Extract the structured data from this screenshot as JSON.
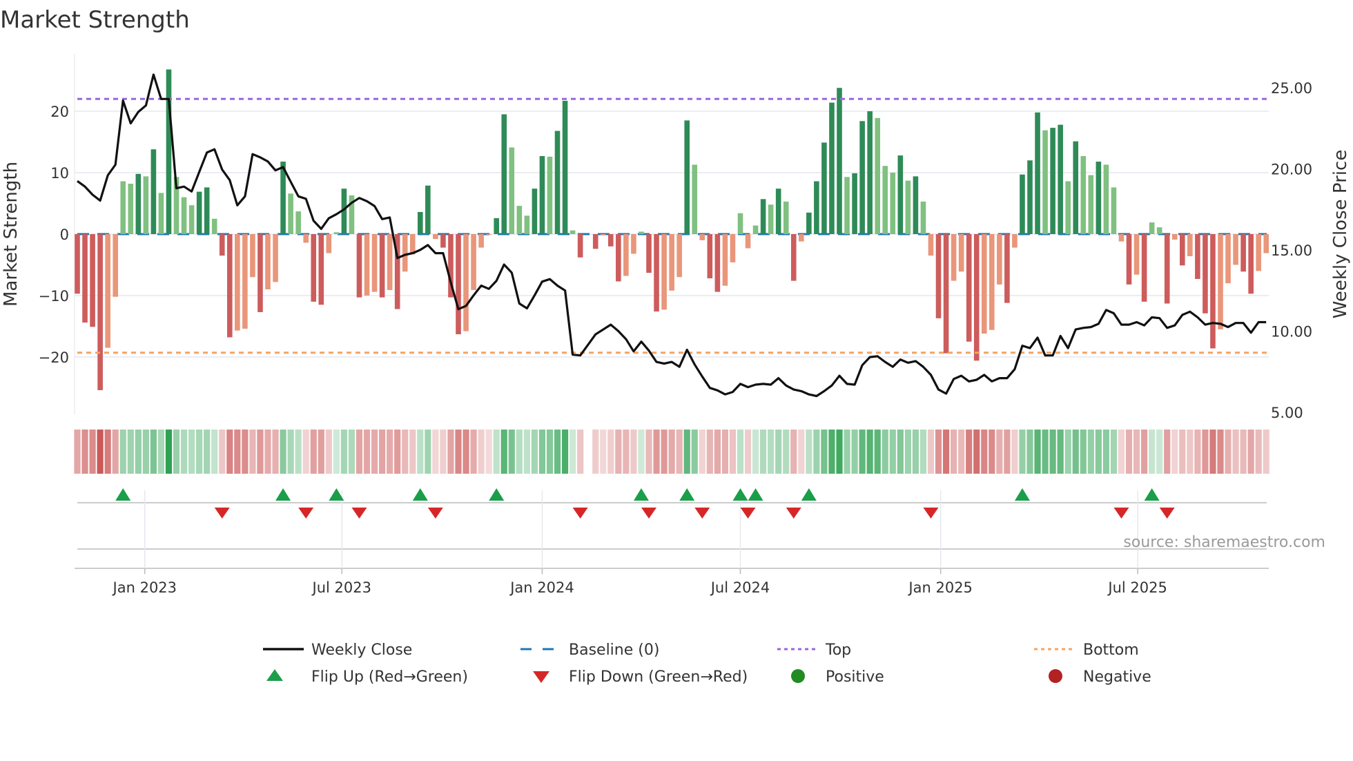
{
  "chart_data": {
    "type": "bar",
    "title": "Market Strength",
    "ylabel": "Market Strength",
    "y2label": "Weekly Close Price",
    "ylim": [
      -29,
      29
    ],
    "y2lim": [
      5,
      26.95
    ],
    "yticks": [
      20,
      10,
      0,
      -10,
      -20
    ],
    "ytick_labels": [
      "20",
      "10",
      "0",
      "−10",
      "−20"
    ],
    "y2ticks": [
      25,
      20,
      15,
      10,
      5
    ],
    "y2tick_labels": [
      "25.00",
      "20.00",
      "15.00",
      "10.00",
      "5.00"
    ],
    "x_start": "2022-10-31",
    "x_frequency": "weekly",
    "xticks": [
      "2023-01-01",
      "2023-07-01",
      "2024-01-01",
      "2024-07-01",
      "2025-01-01",
      "2025-07-01"
    ],
    "xtick_labels": [
      "Jan 2023",
      "Jul 2023",
      "Jan 2024",
      "Jul 2024",
      "Jan 2025",
      "Jul 2025"
    ],
    "top_level": 22,
    "bottom_level": -19.3,
    "baseline": 0,
    "grid": true,
    "legend_placement": "bottom",
    "colors": {
      "green_strong": "#2e8b57",
      "green_weak": "#80c080",
      "red_strong": "#cd5c5c",
      "red_weak": "#e9967a",
      "close": "#111111",
      "baseline": "#1f77b4",
      "top": "#9966dd",
      "bottom": "#f4a460",
      "flip_up": "#1a9e4a",
      "flip_down": "#d62728",
      "positive": "#228b22",
      "negative": "#b22222"
    },
    "strength": [
      -9.7,
      -14.4,
      -15.1,
      -25.4,
      -18.5,
      -10.2,
      8.6,
      8.2,
      9.8,
      9.4,
      13.8,
      6.7,
      26.8,
      9.3,
      6.0,
      4.7,
      6.9,
      7.6,
      2.5,
      -3.5,
      -16.8,
      -15.7,
      -15.4,
      -7.0,
      -12.7,
      -9.0,
      -7.8,
      11.8,
      6.6,
      3.7,
      -1.4,
      -11.0,
      -11.5,
      -3.1,
      0.3,
      7.4,
      6.3,
      -10.3,
      -10.0,
      -9.4,
      -10.3,
      -9.1,
      -12.2,
      -6.1,
      -3.3,
      3.6,
      7.9,
      -0.8,
      -2.2,
      -10.3,
      -16.3,
      -15.8,
      -9.1,
      -2.2,
      -0.1,
      2.6,
      19.5,
      14.1,
      4.6,
      3.0,
      7.4,
      12.7,
      12.6,
      16.8,
      21.7,
      0.6,
      -3.8,
      0,
      -2.4,
      -0.2,
      -2.0,
      -7.7,
      -6.8,
      -3.2,
      0.4,
      -6.3,
      -12.6,
      -12.3,
      -9.2,
      -7.0,
      18.5,
      11.3,
      -1.0,
      -7.2,
      -9.4,
      -8.4,
      -4.6,
      3.4,
      -2.3,
      1.4,
      5.7,
      4.8,
      7.4,
      5.3,
      -7.6,
      -1.2,
      3.5,
      8.6,
      14.9,
      21.4,
      23.8,
      9.3,
      9.9,
      18.4,
      20.0,
      18.9,
      11.1,
      10.0,
      12.8,
      8.7,
      9.4,
      5.3,
      -3.5,
      -13.7,
      -19.4,
      -7.6,
      -6.1,
      -17.5,
      -20.6,
      -16.2,
      -15.6,
      -8.2,
      -11.2,
      -2.2,
      9.7,
      12.0,
      19.8,
      16.9,
      17.3,
      17.8,
      8.6,
      15.1,
      12.7,
      9.6,
      11.8,
      11.3,
      7.6,
      -1.2,
      -8.2,
      -6.6,
      -11.0,
      1.9,
      1.1,
      -11.3,
      -0.9,
      -5.1,
      -3.6,
      -7.3,
      -12.9,
      -18.6,
      -15.5,
      -8.0,
      -5.0,
      -6.1,
      -9.7,
      -6.0,
      -3.1
    ],
    "weekly_close": [
      19.24,
      18.9,
      18.4,
      18.04,
      19.6,
      20.25,
      24.2,
      22.8,
      23.5,
      23.9,
      25.8,
      24.3,
      24.3,
      18.8,
      18.9,
      18.6,
      19.8,
      21.0,
      21.2,
      19.95,
      19.3,
      17.75,
      18.3,
      20.9,
      20.7,
      20.45,
      19.9,
      20.1,
      19.2,
      18.3,
      18.15,
      16.8,
      16.3,
      16.95,
      17.2,
      17.5,
      17.9,
      18.2,
      18.0,
      17.7,
      16.9,
      17.0,
      14.5,
      14.7,
      14.8,
      15.0,
      15.3,
      14.8,
      14.8,
      13.0,
      11.35,
      11.55,
      12.2,
      12.8,
      12.6,
      13.1,
      14.1,
      13.6,
      11.7,
      11.4,
      12.2,
      13.05,
      13.2,
      12.8,
      12.5,
      8.55,
      8.5,
      9.15,
      9.8,
      10.1,
      10.4,
      10.0,
      9.5,
      8.75,
      9.35,
      8.8,
      8.1,
      8.0,
      8.1,
      7.8,
      8.85,
      7.95,
      7.2,
      6.5,
      6.35,
      6.1,
      6.25,
      6.75,
      6.55,
      6.7,
      6.75,
      6.7,
      7.1,
      6.65,
      6.4,
      6.3,
      6.1,
      6.0,
      6.3,
      6.65,
      7.25,
      6.75,
      6.7,
      7.9,
      8.4,
      8.45,
      8.1,
      7.8,
      8.25,
      8.05,
      8.15,
      7.8,
      7.3,
      6.4,
      6.15,
      7.05,
      7.25,
      6.9,
      7.0,
      7.3,
      6.9,
      7.1,
      7.1,
      7.65,
      9.1,
      8.95,
      9.6,
      8.5,
      8.5,
      9.7,
      8.95,
      10.1,
      10.2,
      10.25,
      10.45,
      11.3,
      11.1,
      10.4,
      10.4,
      10.55,
      10.35,
      10.85,
      10.8,
      10.2,
      10.35,
      11.0,
      11.2,
      10.85,
      10.4,
      10.5,
      10.45,
      10.25,
      10.5,
      10.5,
      9.9,
      10.55,
      10.55
    ]
  },
  "legend": {
    "weekly_close": "Weekly Close",
    "baseline": "Baseline (0)",
    "top": "Top",
    "bottom": "Bottom",
    "flip_up": "Flip Up (Red→Green)",
    "flip_down": "Flip Down (Green→Red)",
    "positive": "Positive",
    "negative": "Negative"
  },
  "source": "source: sharemaestro.com"
}
